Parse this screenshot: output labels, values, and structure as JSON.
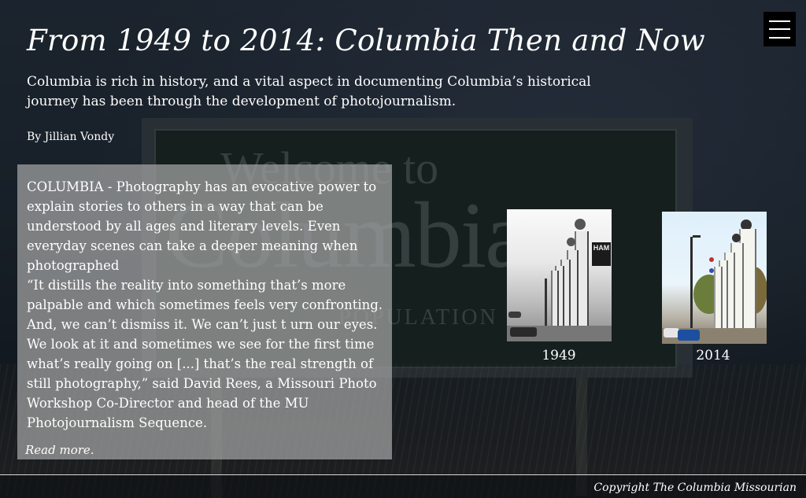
{
  "header": {
    "title": "From 1949 to 2014: Columbia Then and Now",
    "subtitle": "Columbia is rich in history, and a vital aspect in documenting Columbia’s historical journey has been through the development of photojournalism.",
    "byline": "By Jillian Vondy",
    "menu_icon": "hamburger-menu-icon"
  },
  "article": {
    "paragraphs": [
      "COLUMBIA - Photography has an evocative power to explain stories to others in a way that can be understood by all ages and literary levels. Even everyday scenes can take a deeper meaning when photographed",
      "“It distills the reality into something that’s more palpable and which sometimes feels very confronting. And, we can’t dismiss it. We can’t just t urn our eyes. We look at it and sometimes we see for the first time what’s really going on [...] that’s the real strength of still photography,” said David Rees, a Missouri Photo Workshop Co-Director and head of the MU Photojournalism Sequence."
    ],
    "read_more": "Read more."
  },
  "photos": [
    {
      "label": "1949",
      "style": "black-and-white"
    },
    {
      "label": "2014",
      "style": "color"
    }
  ],
  "footer": {
    "copyright": "Copyright The Columbia Missourian"
  },
  "colors": {
    "article_box_bg": "#a5a5a5",
    "menu_button_bg": "#000000",
    "text": "#ffffff"
  }
}
